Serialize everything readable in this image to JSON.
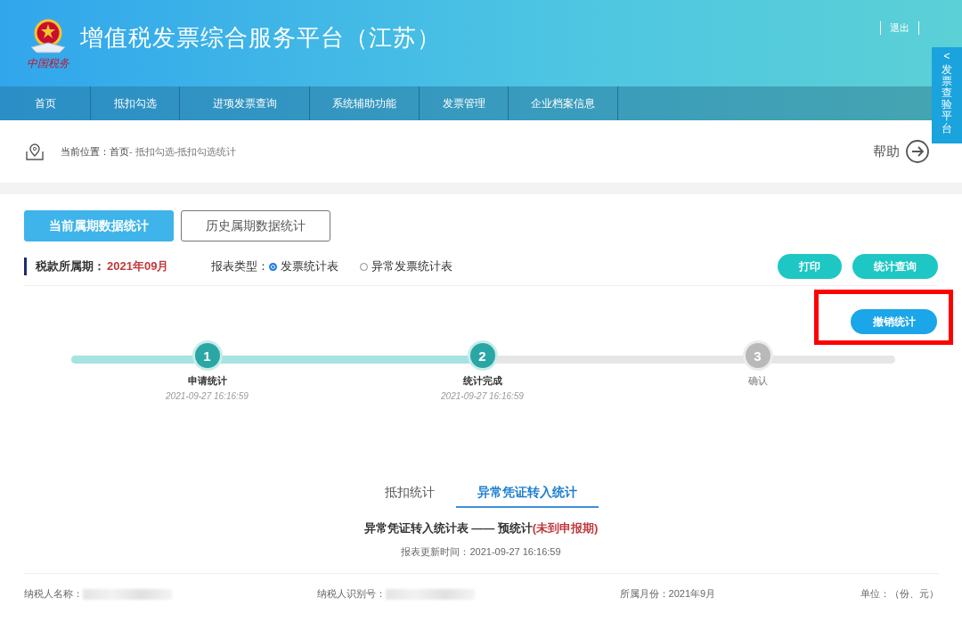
{
  "header": {
    "emblem_caption": "中国税务",
    "title": "增值税发票综合服务平台（江苏）",
    "logout": "退出"
  },
  "side_tab": {
    "arrow": "<",
    "label": "发票查验平台"
  },
  "nav": [
    {
      "label": "首页"
    },
    {
      "label": "抵扣勾选"
    },
    {
      "label": "进项发票查询"
    },
    {
      "label": "系统辅助功能"
    },
    {
      "label": "发票管理"
    },
    {
      "label": "企业档案信息"
    }
  ],
  "breadcrumb": {
    "prefix": "当前位置：",
    "home": "首页",
    "path": " - 抵扣勾选-抵扣勾选统计"
  },
  "help": "帮助",
  "period_tabs": [
    {
      "label": "当前属期数据统计",
      "selected": true
    },
    {
      "label": "历史属期数据统计",
      "selected": false
    }
  ],
  "filter": {
    "period_label": "税款所属期：",
    "period_value": "2021年09月",
    "type_label": "报表类型：",
    "options": [
      {
        "label": "发票统计表",
        "selected": true
      },
      {
        "label": "异常发票统计表",
        "selected": false
      }
    ]
  },
  "actions": [
    {
      "label": "打印"
    },
    {
      "label": "统计查询"
    }
  ],
  "cancel_button": {
    "label": "撤销统计",
    "highlighted": true
  },
  "progress": {
    "level": 0.5,
    "steps": [
      {
        "number": "1",
        "label": "申请统计",
        "time": "2021-09-27 16:16:59",
        "done": true
      },
      {
        "number": "2",
        "label": "统计完成",
        "time": "2021-09-27 16:16:59",
        "done": true
      },
      {
        "number": "3",
        "label": "确认",
        "done": false
      }
    ]
  },
  "report_tabs": [
    {
      "label": "抵扣统计",
      "selected": false
    },
    {
      "label": "异常凭证转入统计",
      "selected": true
    }
  ],
  "report": {
    "title": "异常凭证转入统计表 —— 预统计",
    "status": "(未到申报期)",
    "updated": "报表更新时间：2021-09-27 16:16:59"
  },
  "info": [
    {
      "label": "纳税人名称：",
      "redacted": true
    },
    {
      "label": "纳税人识别号：",
      "redacted": true
    },
    {
      "label": "所属月份：2021年9月",
      "redacted": false
    },
    {
      "label": "单位：（份、元）",
      "redacted": false
    }
  ]
}
